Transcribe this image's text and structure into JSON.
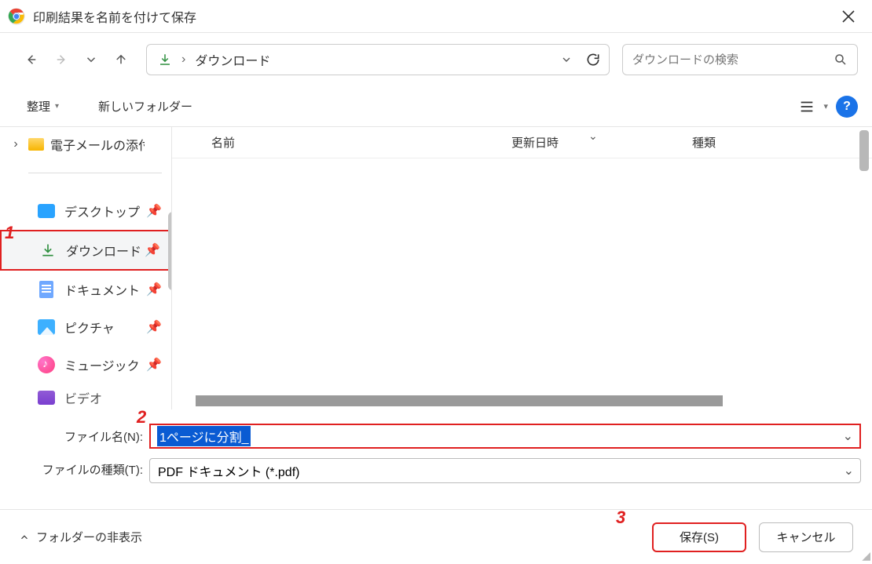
{
  "window": {
    "title": "印刷結果を名前を付けて保存"
  },
  "address": {
    "crumb": "ダウンロード",
    "search_placeholder": "ダウンロードの検索"
  },
  "toolbar": {
    "organize": "整理",
    "new_folder": "新しいフォルダー"
  },
  "tree": {
    "first_folder": "電子メールの添付"
  },
  "quick_access": {
    "desktop": "デスクトップ",
    "downloads": "ダウンロード",
    "documents": "ドキュメント",
    "pictures": "ピクチャ",
    "music": "ミュージック",
    "videos": "ビデオ"
  },
  "columns": {
    "name": "名前",
    "date": "更新日時",
    "type": "種類"
  },
  "filename": {
    "label": "ファイル名(N):",
    "value": "1ページに分割_"
  },
  "filetype": {
    "label": "ファイルの種類(T):",
    "value": "PDF ドキュメント (*.pdf)"
  },
  "footer": {
    "hide_folders": "フォルダーの非表示",
    "save": "保存(S)",
    "cancel": "キャンセル"
  },
  "annotations": {
    "a1": "1",
    "a2": "2",
    "a3": "3"
  }
}
